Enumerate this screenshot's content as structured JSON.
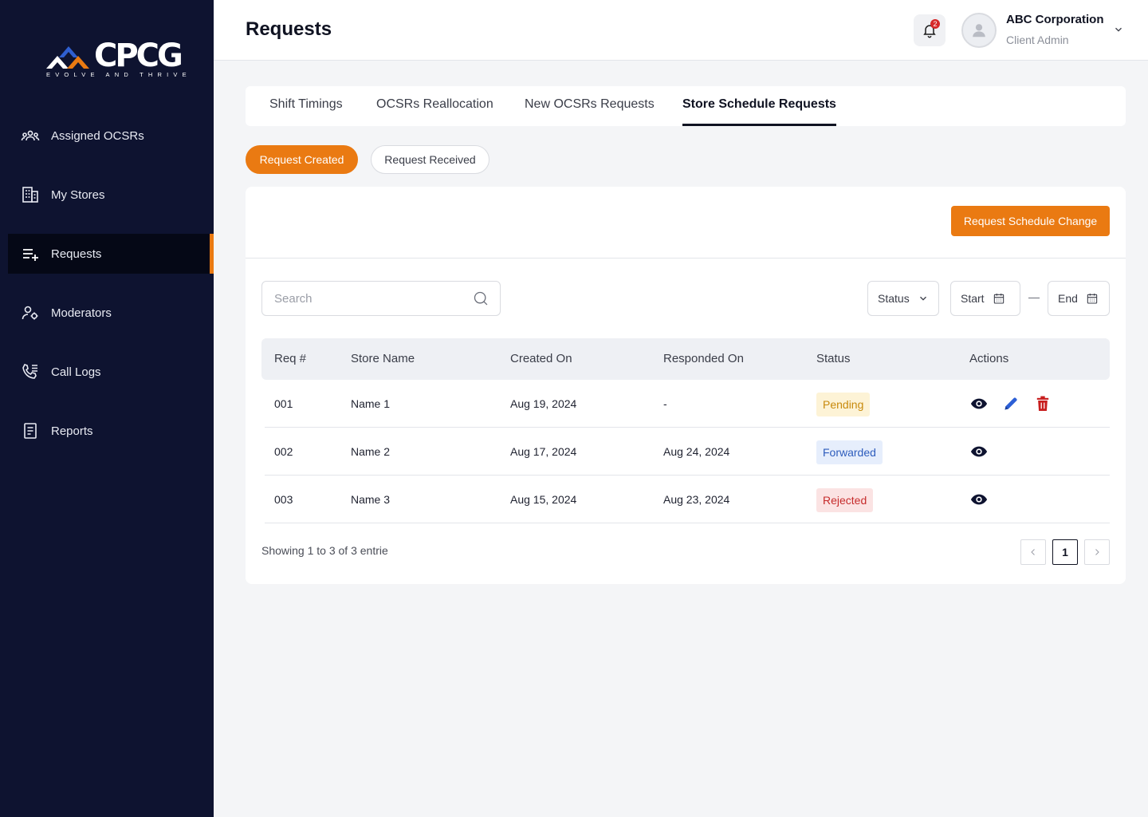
{
  "brand": {
    "logo_text": "CPCG",
    "tagline": "EVOLVE AND THRIVE",
    "accent": "#ea7a12",
    "sidebar_bg": "#0e1330"
  },
  "sidebar": {
    "items": [
      {
        "label": "Assigned OCSRs",
        "icon": "users-icon"
      },
      {
        "label": "My Stores",
        "icon": "stores-icon"
      },
      {
        "label": "Requests",
        "icon": "requests-icon",
        "active": true
      },
      {
        "label": "Moderators",
        "icon": "moderators-icon"
      },
      {
        "label": "Call Logs",
        "icon": "call-logs-icon"
      },
      {
        "label": "Reports",
        "icon": "reports-icon"
      }
    ]
  },
  "header": {
    "title": "Requests",
    "notification_count": "2",
    "user_name": "ABC Corporation",
    "user_role": "Client Admin"
  },
  "tabs": [
    {
      "label": "Shift Timings"
    },
    {
      "label": "OCSRs Reallocation"
    },
    {
      "label": "New OCSRs Requests"
    },
    {
      "label": "Store Schedule Requests",
      "active": true
    }
  ],
  "pills": [
    {
      "label": "Request Created",
      "active": true
    },
    {
      "label": "Request Received"
    }
  ],
  "card": {
    "primary_button": "Request Schedule Change",
    "search_placeholder": "Search",
    "filters": {
      "status": "Status",
      "start": "Start",
      "end": "End"
    }
  },
  "table": {
    "columns": [
      "Req #",
      "Store Name",
      "Created On",
      "Responded On",
      "Status",
      "Actions"
    ],
    "rows": [
      {
        "req": "001",
        "store": "Name 1",
        "created": "Aug 19, 2024",
        "responded": "-",
        "status": "Pending",
        "actions": [
          "view",
          "edit",
          "delete"
        ]
      },
      {
        "req": "002",
        "store": "Name 2",
        "created": "Aug 17, 2024",
        "responded": "Aug 24, 2024",
        "status": "Forwarded",
        "actions": [
          "view"
        ]
      },
      {
        "req": "003",
        "store": "Name 3",
        "created": "Aug 15, 2024",
        "responded": "Aug 23, 2024",
        "status": "Rejected",
        "actions": [
          "view"
        ]
      }
    ]
  },
  "pagination": {
    "summary": "Showing 1 to 3 of 3 entrie",
    "current_page": "1"
  },
  "status_colors": {
    "pending": "#c88a0c",
    "forwarded": "#2e5dbd",
    "rejected": "#c62b2b"
  }
}
